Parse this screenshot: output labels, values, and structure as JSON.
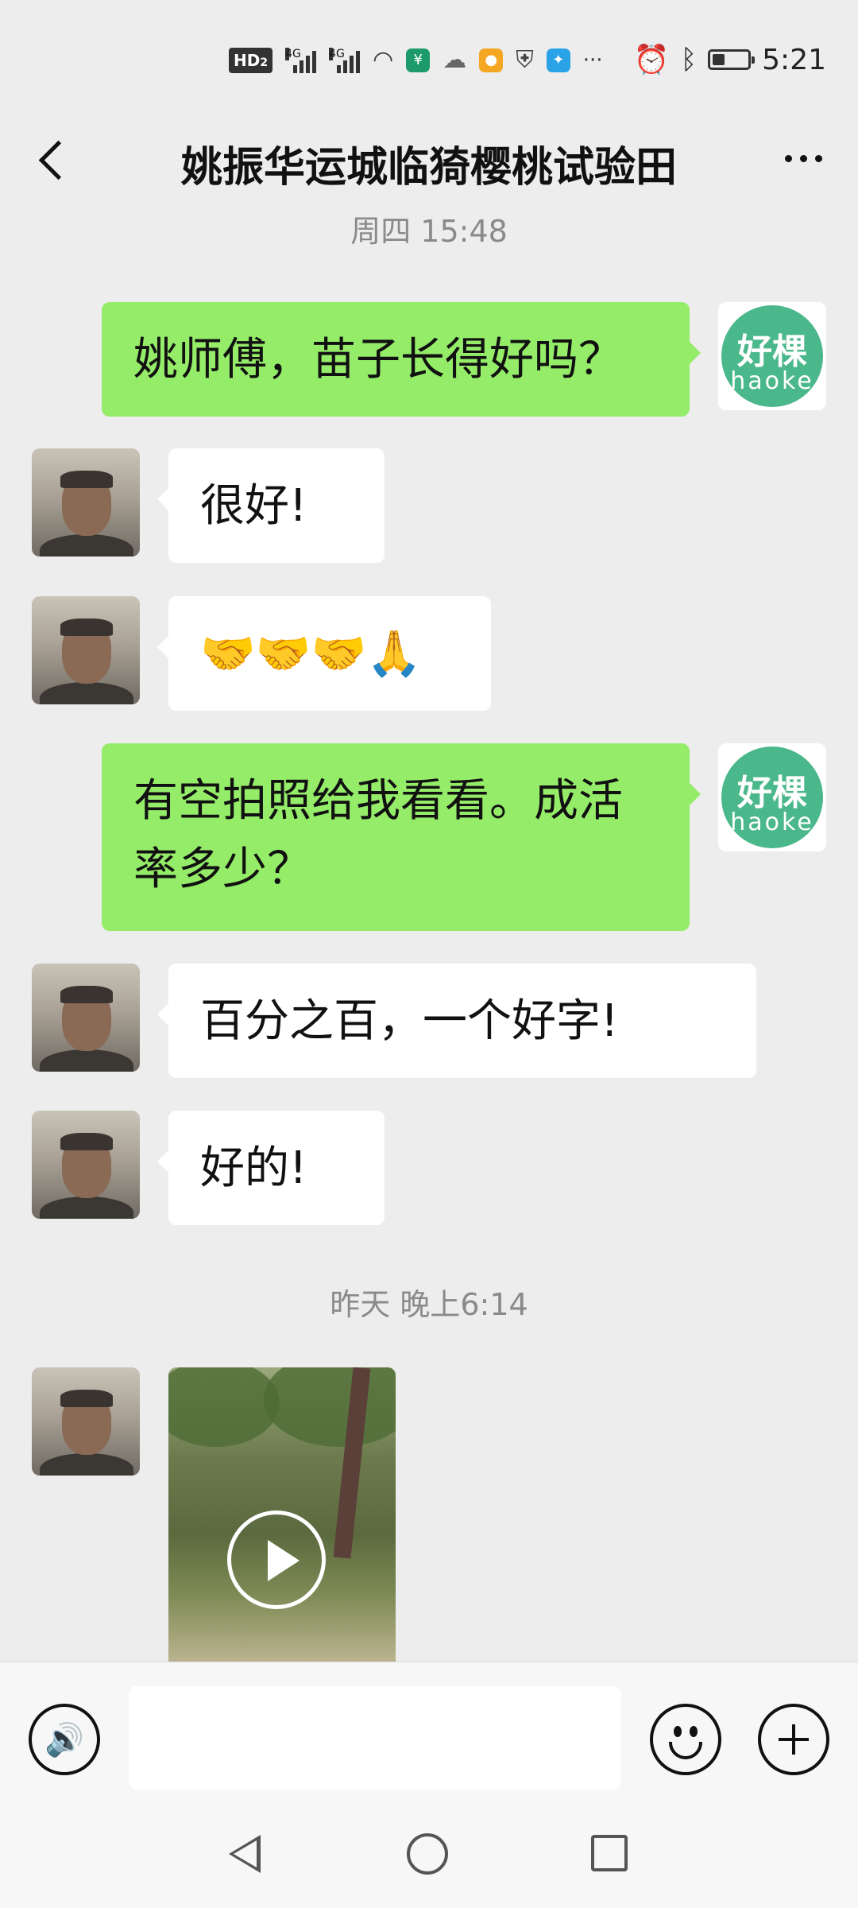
{
  "status_bar": {
    "hd_label": "HD",
    "hd_sub": "2",
    "net1": "4G",
    "net2": "4G",
    "dots": "···",
    "time": "5:21",
    "battery_level": 0.35
  },
  "header": {
    "title": "姚振华运城临猗樱桃试验田"
  },
  "brand_avatar": {
    "cn": "好棵",
    "en": "haoke",
    "color": "#4ab88a"
  },
  "chat": {
    "top_time": "周四 15:48",
    "messages": [
      {
        "side": "out",
        "text": "姚师傅，苗子长得好吗？"
      },
      {
        "side": "in",
        "text": "很好!"
      },
      {
        "side": "in",
        "text": "🤝🤝🤝🙏"
      },
      {
        "side": "out",
        "text": "有空拍照给我看看。成活率多少？"
      },
      {
        "side": "in",
        "text": "百分之百，一个好字!"
      },
      {
        "side": "in",
        "text": "好的!"
      }
    ],
    "time_divider": "昨天 晚上6:14"
  },
  "colors": {
    "outgoing_bubble": "#95ec69",
    "incoming_bubble": "#ffffff",
    "background": "#ededed"
  }
}
